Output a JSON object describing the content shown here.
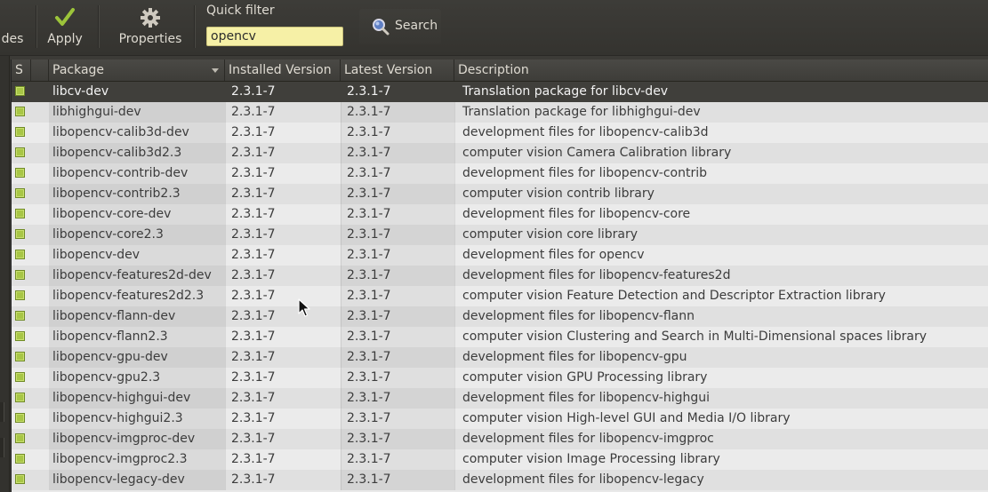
{
  "toolbar": {
    "codes_label": "des",
    "apply_label": "Apply",
    "properties_label": "Properties",
    "quick_filter_label": "Quick filter",
    "quick_filter_value": "opencv",
    "search_label": "Search"
  },
  "columns": {
    "status": "S",
    "package": "Package",
    "installed": "Installed Version",
    "latest": "Latest Version",
    "description": "Description"
  },
  "colors": {
    "selected_row": "#403f3b",
    "status_box": "#a8c646",
    "filter_bg": "#f6f0a6"
  },
  "packages": [
    {
      "name": "libcv-dev",
      "installed": "2.3.1-7",
      "latest": "2.3.1-7",
      "description": "Translation package for libcv-dev",
      "selected": true
    },
    {
      "name": "libhighgui-dev",
      "installed": "2.3.1-7",
      "latest": "2.3.1-7",
      "description": "Translation package for libhighgui-dev"
    },
    {
      "name": "libopencv-calib3d-dev",
      "installed": "2.3.1-7",
      "latest": "2.3.1-7",
      "description": "development files for libopencv-calib3d"
    },
    {
      "name": "libopencv-calib3d2.3",
      "installed": "2.3.1-7",
      "latest": "2.3.1-7",
      "description": "computer vision Camera Calibration library"
    },
    {
      "name": "libopencv-contrib-dev",
      "installed": "2.3.1-7",
      "latest": "2.3.1-7",
      "description": "development files for libopencv-contrib"
    },
    {
      "name": "libopencv-contrib2.3",
      "installed": "2.3.1-7",
      "latest": "2.3.1-7",
      "description": "computer vision contrib library"
    },
    {
      "name": "libopencv-core-dev",
      "installed": "2.3.1-7",
      "latest": "2.3.1-7",
      "description": "development files for libopencv-core"
    },
    {
      "name": "libopencv-core2.3",
      "installed": "2.3.1-7",
      "latest": "2.3.1-7",
      "description": "computer vision core library"
    },
    {
      "name": "libopencv-dev",
      "installed": "2.3.1-7",
      "latest": "2.3.1-7",
      "description": "development files for opencv"
    },
    {
      "name": "libopencv-features2d-dev",
      "installed": "2.3.1-7",
      "latest": "2.3.1-7",
      "description": "development files for libopencv-features2d"
    },
    {
      "name": "libopencv-features2d2.3",
      "installed": "2.3.1-7",
      "latest": "2.3.1-7",
      "description": "computer vision Feature Detection and Descriptor Extraction library"
    },
    {
      "name": "libopencv-flann-dev",
      "installed": "2.3.1-7",
      "latest": "2.3.1-7",
      "description": "development files for libopencv-flann"
    },
    {
      "name": "libopencv-flann2.3",
      "installed": "2.3.1-7",
      "latest": "2.3.1-7",
      "description": "computer vision Clustering and Search in Multi-Dimensional spaces library"
    },
    {
      "name": "libopencv-gpu-dev",
      "installed": "2.3.1-7",
      "latest": "2.3.1-7",
      "description": "development files for libopencv-gpu"
    },
    {
      "name": "libopencv-gpu2.3",
      "installed": "2.3.1-7",
      "latest": "2.3.1-7",
      "description": "computer vision GPU Processing library"
    },
    {
      "name": "libopencv-highgui-dev",
      "installed": "2.3.1-7",
      "latest": "2.3.1-7",
      "description": "development files for libopencv-highgui"
    },
    {
      "name": "libopencv-highgui2.3",
      "installed": "2.3.1-7",
      "latest": "2.3.1-7",
      "description": "computer vision High-level GUI and Media I/O library"
    },
    {
      "name": "libopencv-imgproc-dev",
      "installed": "2.3.1-7",
      "latest": "2.3.1-7",
      "description": "development files for libopencv-imgproc"
    },
    {
      "name": "libopencv-imgproc2.3",
      "installed": "2.3.1-7",
      "latest": "2.3.1-7",
      "description": "computer vision Image Processing library"
    },
    {
      "name": "libopencv-legacy-dev",
      "installed": "2.3.1-7",
      "latest": "2.3.1-7",
      "description": "development files for libopencv-legacy"
    }
  ]
}
